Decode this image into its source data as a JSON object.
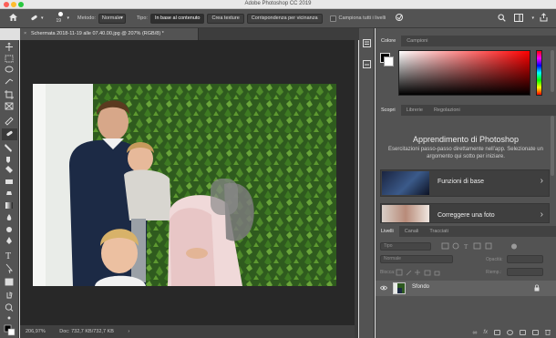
{
  "window": {
    "title": "Adobe Photoshop CC 2019"
  },
  "options": {
    "brush_size": "19",
    "method_label": "Metodo:",
    "method_value": "Normale",
    "type_label": "Tipo:",
    "type_content_aware": "In base al contenuto",
    "type_create_texture": "Crea texture",
    "type_proximity": "Corrispondenza per vicinanza",
    "sample_all_layers": "Campiona tutti i livelli"
  },
  "document": {
    "tab_title": "Schermata 2018-11-19 alle 07.40.00.jpg @ 207% (RGB/8) *",
    "close_symbol": "×"
  },
  "status": {
    "zoom": "206,97%",
    "doc_info": "Doc: 732,7 KB/732,7 KB"
  },
  "color_panel": {
    "tab_color": "Colore",
    "tab_swatches": "Campioni"
  },
  "learn_panel": {
    "tab_learn": "Scopri",
    "tab_libraries": "Librerie",
    "tab_adjustments": "Regolazioni",
    "title": "Apprendimento di Photoshop",
    "description": "Esercitazioni passo-passo direttamente nell'app. Selezionate un argomento qui sotto per iniziare.",
    "cards": [
      {
        "label": "Funzioni di base"
      },
      {
        "label": "Correggere una foto"
      }
    ]
  },
  "layers_panel": {
    "tab_layers": "Livelli",
    "tab_channels": "Canali",
    "tab_paths": "Tracciati",
    "filter_placeholder": "Tipo",
    "blend_mode": "Normale",
    "opacity_label": "Opacità:",
    "lock_label": "Blocca:",
    "fill_label": "Riemp.:",
    "layers": [
      {
        "name": "Sfondo"
      }
    ]
  },
  "colors": {
    "ui_dark": "#535353",
    "canvas_bg": "#282828",
    "foreground": "#000000",
    "background": "#ffffff"
  }
}
